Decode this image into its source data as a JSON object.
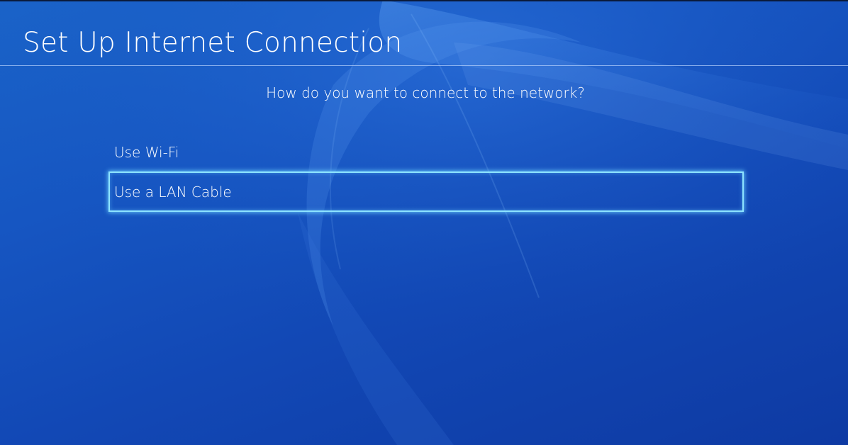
{
  "header": {
    "title": "Set Up Internet Connection"
  },
  "main": {
    "prompt": "How do you want to connect to the network?",
    "options": [
      {
        "label": "Use Wi-Fi",
        "selected": false
      },
      {
        "label": "Use a LAN Cable",
        "selected": true
      }
    ]
  },
  "theme": {
    "background": "#1656c2",
    "focus_outline": "#8ee4ff"
  }
}
